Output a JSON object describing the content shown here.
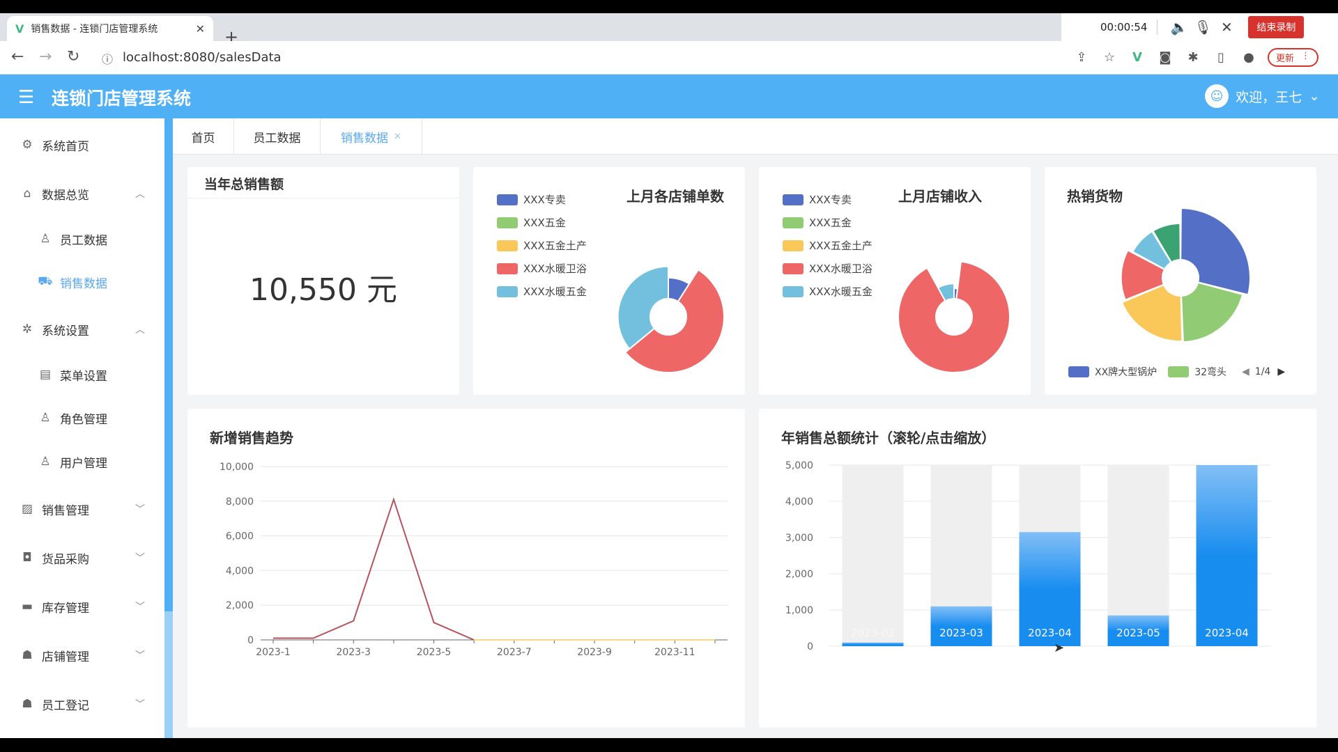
{
  "browser": {
    "tab_title": "销售数据 - 连锁门店管理系统",
    "url": "localhost:8080/salesData",
    "recording_time": "00:00:54",
    "stop_recording_label": "结束录制",
    "update_label": "更新"
  },
  "app": {
    "title": "连锁门店管理系统",
    "welcome": "欢迎，王七"
  },
  "sidebar": {
    "items": [
      {
        "label": "系统首页",
        "icon": "gear-icon"
      },
      {
        "label": "数据总览",
        "icon": "home-icon"
      },
      {
        "label": "员工数据",
        "icon": "user-icon"
      },
      {
        "label": "销售数据",
        "icon": "truck-icon"
      },
      {
        "label": "系统设置",
        "icon": "settings-icon"
      },
      {
        "label": "菜单设置",
        "icon": "document-icon"
      },
      {
        "label": "角色管理",
        "icon": "user-icon"
      },
      {
        "label": "用户管理",
        "icon": "user-icon"
      },
      {
        "label": "销售管理",
        "icon": "chart-icon"
      },
      {
        "label": "货品采购",
        "icon": "bag-icon"
      },
      {
        "label": "库存管理",
        "icon": "briefcase-icon"
      },
      {
        "label": "店铺管理",
        "icon": "person-icon"
      },
      {
        "label": "员工登记",
        "icon": "person-icon"
      }
    ]
  },
  "page_tabs": [
    {
      "label": "首页"
    },
    {
      "label": "员工数据"
    },
    {
      "label": "销售数据",
      "active": true
    }
  ],
  "cards": {
    "total_sales": {
      "title": "当年总销售额",
      "value": "10,550 元"
    },
    "store_orders": {
      "title": "上月各店铺单数"
    },
    "store_income": {
      "title": "上月店铺收入"
    },
    "hot_goods": {
      "title": "热销货物",
      "pager": "1/4"
    },
    "trend": {
      "title": "新增销售趋势"
    },
    "annual": {
      "title": "年销售总额统计（滚轮/点击缩放）"
    }
  },
  "colors": {
    "blue": "#5470c6",
    "green": "#91cc75",
    "yellow": "#fac858",
    "red": "#ee6666",
    "cyan": "#73c0de",
    "teal": "#3ba272",
    "header": "#4fb0f5"
  },
  "chart_data": [
    {
      "type": "pie",
      "title": "上月各店铺单数",
      "legend": [
        "XXX专卖",
        "XXX五金",
        "XXX五金土产",
        "XXX水暖卫浴",
        "XXX水暖五金"
      ],
      "values": [
        9,
        0,
        0,
        55,
        36
      ]
    },
    {
      "type": "pie",
      "title": "上月店铺收入",
      "legend": [
        "XXX专卖",
        "XXX五金",
        "XXX五金土产",
        "XXX水暖卫浴",
        "XXX水暖五金"
      ],
      "values": [
        2,
        0,
        0,
        90,
        8
      ]
    },
    {
      "type": "pie",
      "title": "热销货物",
      "legend": [
        "XX牌大型锅炉",
        "32弯头"
      ],
      "values": [
        27,
        19,
        18,
        13,
        8,
        8
      ]
    },
    {
      "type": "line",
      "title": "新增销售趋势",
      "x": [
        "2023-1",
        "2023-2",
        "2023-3",
        "2023-4",
        "2023-5",
        "2023-6",
        "2023-7",
        "2023-8",
        "2023-9",
        "2023-10",
        "2023-11",
        "2023-12"
      ],
      "x_ticks": [
        "2023-1",
        "2023-3",
        "2023-5",
        "2023-7",
        "2023-9",
        "2023-11"
      ],
      "series": [
        {
          "values": [
            100,
            100,
            1100,
            8100,
            1000,
            0,
            0,
            0,
            0,
            0,
            0,
            0
          ]
        }
      ],
      "ylim": [
        0,
        10000
      ],
      "y_ticks": [
        "0",
        "2,000",
        "4,000",
        "6,000",
        "8,000",
        "10,000"
      ]
    },
    {
      "type": "bar",
      "title": "年销售总额统计（滚轮/点击缩放）",
      "categories": [
        "2023-02",
        "2023-03",
        "2023-04",
        "2023-05",
        "2023-04"
      ],
      "values": [
        100,
        1100,
        3150,
        850,
        5000
      ],
      "ylim": [
        0,
        5000
      ],
      "y_ticks": [
        "0",
        "1,000",
        "2,000",
        "3,000",
        "4,000",
        "5,000"
      ]
    }
  ]
}
